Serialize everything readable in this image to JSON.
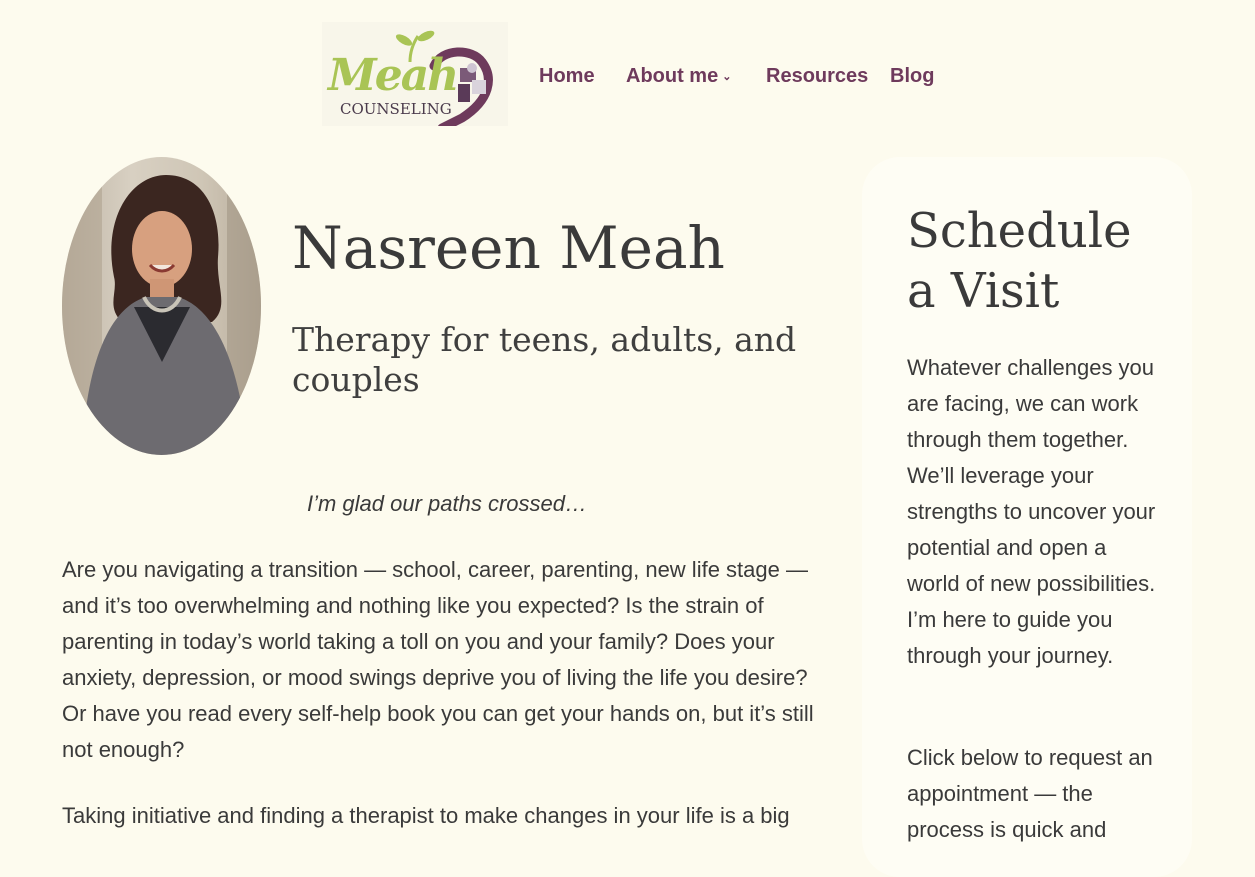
{
  "header": {
    "logo": {
      "word": "Meah",
      "sub": "COUNSELING"
    },
    "nav": [
      {
        "label": "Home"
      },
      {
        "label": "About me",
        "has_dropdown": true
      },
      {
        "label": "Resources"
      },
      {
        "label": "Blog"
      }
    ],
    "nav_color": "#6e3a5c"
  },
  "hero": {
    "name": "Nasreen Meah",
    "tagline": "Therapy for teens, adults, and couples"
  },
  "main": {
    "intro": "I’m glad our paths crossed…",
    "paragraphs": [
      "Are you navigating a transition — school, career, parenting, new life stage — and it’s too overwhelming and nothing like you expected? Is the strain of parenting in today’s world taking a toll on you and your family? Does your anxiety, depression, or mood swings deprive you of living the life you desire? Or have you read every self-help book you can get your hands on, but it’s still not enough?",
      "Taking initiative and finding a therapist to make changes in your life is a big"
    ]
  },
  "sidebar": {
    "title": "Schedule a Visit",
    "text1": "Whatever challenges you are facing, we can work through them together. We’ll leverage your strengths to uncover your potential and open a world of new possibilities. I’m here to guide you through your journey.",
    "text2": "Click below to request an appointment — the process is quick and"
  },
  "colors": {
    "background": "#fdfbee",
    "logo_green": "#a9c455",
    "logo_purple": "#6e3a5c"
  }
}
